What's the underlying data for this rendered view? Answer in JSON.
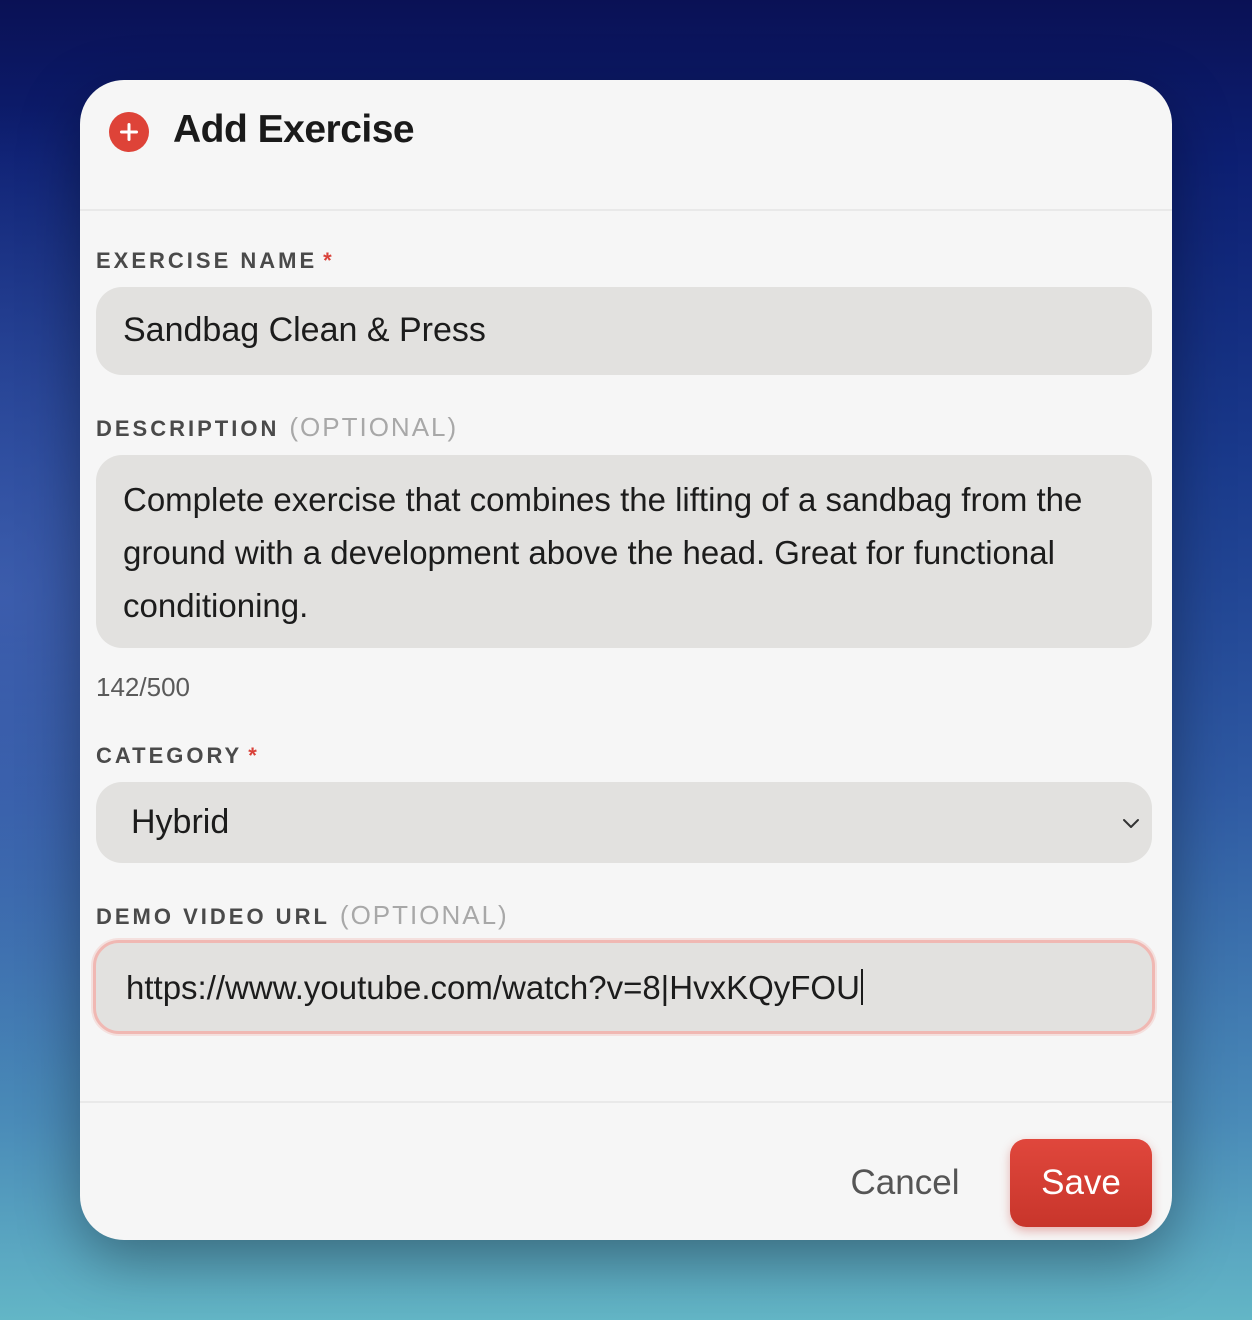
{
  "dialog": {
    "title": "Add Exercise",
    "icon": "plus-circle-icon",
    "accent_color": "#de4338"
  },
  "fields": {
    "name": {
      "label": "EXERCISE NAME",
      "required_mark": "*",
      "value": "Sandbag Clean & Press"
    },
    "description": {
      "label": "DESCRIPTION",
      "optional_text": "(OPTIONAL)",
      "value": "Complete exercise that combines the lifting of a sandbag from the ground with a development above the head. Great for functional conditioning.",
      "counter": "142/500"
    },
    "category": {
      "label": "CATEGORY",
      "required_mark": "*",
      "selected": "Hybrid"
    },
    "video_url": {
      "label": "DEMO VIDEO URL",
      "optional_text": "(OPTIONAL)",
      "value": "https://www.youtube.com/watch?v=8|HvxKQyFOU"
    }
  },
  "actions": {
    "cancel_label": "Cancel",
    "save_label": "Save"
  }
}
